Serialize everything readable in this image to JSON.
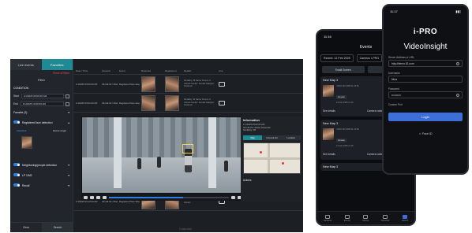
{
  "desktop": {
    "tabs": [
      "Live events",
      "Favorites"
    ],
    "subhead": {
      "left": "",
      "reset": "Reset all filters"
    },
    "filter_title": "Filter",
    "condition_label": "CONDITION",
    "start_label": "Start",
    "start_value": "1/1/2025 09:00:00 AM",
    "end_label": "End",
    "end_value": "1/1/2025 10:00:00 AM",
    "favorite_label": "Favorite (2)",
    "registered_label": "Registered face detection",
    "links": {
      "favorites": "Favorites",
      "delete": "Delete target"
    },
    "neighbor_label": "Neighboring/people detection",
    "lpr_label": "LP 1/M2",
    "recall_label": "Recall",
    "bottom": {
      "clear": "Clear",
      "search": "Search"
    },
    "grid_headers": [
      "Date / Time",
      "Camera",
      "Event",
      "Detected",
      "Registered",
      "Details",
      "Live"
    ],
    "rows": [
      {
        "date": "1/1/2025 09:00:00 AM",
        "camera": "SK-H9-02 / Model Networks",
        "event": "Registered face detection",
        "details": "Similarity: 95  Name: Person of Interest  Gender: Female  Category: Customer",
        "live": ""
      },
      {
        "date": "1/1/2025 09:02:00 AM",
        "camera": "SK-H9-02 / Model Networks",
        "event": "Registered face detection",
        "details": "Similarity: 92  Name: Person of Interest  Gender: Female  Category: Customer",
        "live": ""
      },
      {
        "date": "1/1/2025 09:10:00 AM",
        "camera": "SK-H9-02 / Model Networks",
        "event": "Registered face detection",
        "details": "Similarity: 90  Name: Person of Interest",
        "live": ""
      }
    ],
    "info": {
      "title": "Information",
      "lines": [
        "1/1/2025 09:00:00 AM",
        "SK-H9-02 / Model Networks",
        "Similarity: 95"
      ],
      "tabs": [
        "Map",
        "Camera list",
        "Location"
      ],
      "actions": "Actions"
    },
    "footer": "© 2025 i-PRO"
  },
  "phone_events": {
    "time": "11:16",
    "title": "Events",
    "recent": "Recent: 12 Feb 2025",
    "camera": "Camera: i-PRO",
    "modes": [
      "Small Screen",
      "List"
    ],
    "cards": [
      {
        "title": "New Map 3",
        "meta": "i-PRO WV-X8571L 23:51",
        "sub": "12 Feb 2025 11:16",
        "tag": "Female",
        "details": "See details",
        "context": "Camera context"
      },
      {
        "title": "New Map 3",
        "meta": "i-PRO WV-X8571L 23:50",
        "sub": "12 Feb 2025 11:15",
        "tag": "Female",
        "details": "See details",
        "context": "Camera context"
      },
      {
        "title": "New Map 3",
        "meta": "Recent events",
        "sub": "",
        "tag": "",
        "details": "",
        "context": ""
      }
    ],
    "nav": [
      "Cameras",
      "Events",
      "Alarms",
      "Favorites",
      "Search"
    ]
  },
  "phone_login": {
    "time": "11:17",
    "logo": "i-PRO",
    "brand": "VideoInsight",
    "server_label": "Server Address or URL",
    "server_value": "http://demo.ID.com",
    "user_label": "Username",
    "user_value": "Nina",
    "pass_label": "Password",
    "pass_value": "••••••••••",
    "port_label": "Custom Port",
    "login": "Login",
    "faceid": "Face ID"
  }
}
